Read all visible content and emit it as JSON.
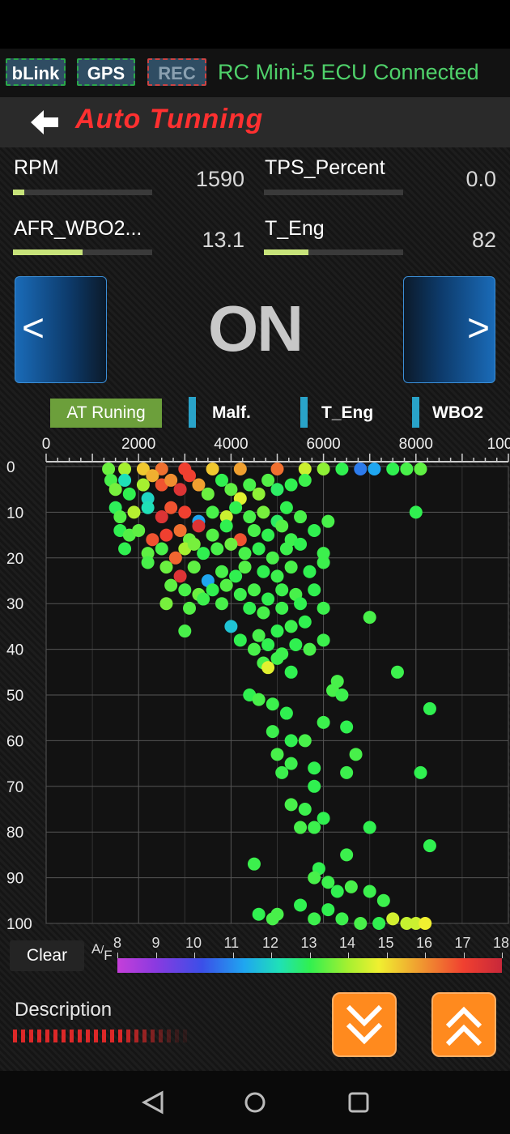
{
  "top": {
    "tags": [
      "bLink",
      "GPS",
      "REC"
    ],
    "connection": "RC Mini-5 ECU Connected"
  },
  "header": {
    "title": "Auto Tunning"
  },
  "gauges": [
    {
      "label": "RPM",
      "value": "1590",
      "fill": 0.08
    },
    {
      "label": "TPS_Percent",
      "value": "0.0",
      "fill": 0.0
    },
    {
      "label": "AFR_WBO2...",
      "value": "13.1",
      "fill": 0.5
    },
    {
      "label": "T_Eng",
      "value": "82",
      "fill": 0.32
    }
  ],
  "mode": {
    "state": "ON",
    "prev": "<",
    "next": ">"
  },
  "legend": {
    "at": "AT Runing",
    "items": [
      "Malf.",
      "T_Eng",
      "WBO2"
    ],
    "marker_color": "#29a3c9"
  },
  "chart_data": {
    "type": "scatter",
    "xlabel": "",
    "ylabel": "",
    "xticks": [
      "0",
      "2000",
      "4000",
      "6000",
      "8000",
      "10000"
    ],
    "yticks": [
      "0",
      "10",
      "20",
      "30",
      "40",
      "50",
      "60",
      "70",
      "80",
      "90",
      "100"
    ],
    "xlim": [
      0,
      10000
    ],
    "ylim": [
      0,
      100
    ],
    "color_scale": {
      "label": "A/F",
      "ticks": [
        "8",
        "9",
        "10",
        "11",
        "12",
        "13",
        "14",
        "15",
        "16",
        "17",
        "18"
      ],
      "min": 8,
      "max": 18
    },
    "points": [
      [
        1350,
        0,
        13.5
      ],
      [
        1700,
        0,
        14.0
      ],
      [
        2100,
        0,
        15.5
      ],
      [
        2500,
        0,
        16.5
      ],
      [
        3000,
        0,
        17.0
      ],
      [
        3600,
        0,
        15.5
      ],
      [
        4200,
        0,
        16.0
      ],
      [
        5000,
        0,
        16.5
      ],
      [
        5600,
        0,
        14.5
      ],
      [
        6000,
        0,
        13.8
      ],
      [
        6400,
        0,
        13.0
      ],
      [
        6800,
        0,
        10.5
      ],
      [
        7100,
        0,
        11.0
      ],
      [
        7500,
        0,
        13.0
      ],
      [
        7800,
        0,
        13.2
      ],
      [
        8100,
        0,
        13.4
      ],
      [
        1400,
        3,
        13.2
      ],
      [
        1500,
        5,
        13.6
      ],
      [
        1700,
        3,
        12.0
      ],
      [
        1800,
        6,
        13.0
      ],
      [
        2100,
        4,
        14.0
      ],
      [
        2200,
        7,
        11.8
      ],
      [
        2300,
        2,
        15.8
      ],
      [
        2500,
        4,
        16.8
      ],
      [
        2700,
        3,
        16.2
      ],
      [
        2900,
        5,
        17.5
      ],
      [
        3100,
        2,
        17.0
      ],
      [
        3300,
        4,
        16.0
      ],
      [
        3500,
        6,
        13.5
      ],
      [
        3800,
        3,
        13.0
      ],
      [
        4000,
        5,
        13.4
      ],
      [
        4200,
        7,
        14.8
      ],
      [
        4400,
        4,
        13.2
      ],
      [
        4600,
        6,
        13.8
      ],
      [
        4800,
        3,
        13.3
      ],
      [
        5000,
        5,
        12.8
      ],
      [
        5300,
        4,
        13.0
      ],
      [
        5600,
        3,
        13.1
      ],
      [
        1500,
        9,
        12.9
      ],
      [
        1600,
        11,
        13.3
      ],
      [
        1900,
        10,
        14.2
      ],
      [
        2200,
        9,
        12.0
      ],
      [
        2500,
        11,
        17.5
      ],
      [
        2700,
        9,
        16.8
      ],
      [
        3000,
        10,
        17.0
      ],
      [
        3300,
        12,
        11.0
      ],
      [
        3600,
        10,
        13.2
      ],
      [
        3900,
        11,
        14.5
      ],
      [
        4100,
        9,
        13.0
      ],
      [
        4400,
        11,
        13.2
      ],
      [
        4700,
        10,
        13.6
      ],
      [
        5000,
        12,
        12.8
      ],
      [
        5200,
        9,
        13.0
      ],
      [
        5500,
        11,
        13.2
      ],
      [
        8000,
        10,
        13.0
      ],
      [
        1600,
        14,
        13.0
      ],
      [
        1800,
        15,
        13.3
      ],
      [
        2000,
        14,
        13.4
      ],
      [
        2300,
        16,
        16.8
      ],
      [
        2600,
        15,
        17.0
      ],
      [
        2900,
        14,
        16.5
      ],
      [
        3100,
        16,
        13.5
      ],
      [
        3300,
        13,
        17.5
      ],
      [
        3600,
        15,
        13.3
      ],
      [
        3900,
        13,
        13.0
      ],
      [
        4200,
        16,
        16.8
      ],
      [
        4500,
        14,
        13.2
      ],
      [
        4800,
        15,
        13.0
      ],
      [
        5100,
        13,
        13.3
      ],
      [
        5300,
        16,
        13.1
      ],
      [
        5800,
        14,
        13.0
      ],
      [
        6100,
        12,
        13.2
      ],
      [
        1700,
        18,
        13.0
      ],
      [
        2200,
        19,
        13.4
      ],
      [
        2500,
        18,
        13.2
      ],
      [
        2800,
        20,
        16.6
      ],
      [
        3000,
        18,
        14.0
      ],
      [
        3200,
        17,
        13.6
      ],
      [
        3400,
        19,
        13.0
      ],
      [
        3700,
        18,
        13.2
      ],
      [
        4000,
        17,
        13.5
      ],
      [
        4300,
        19,
        13.2
      ],
      [
        4600,
        18,
        13.0
      ],
      [
        4900,
        20,
        13.2
      ],
      [
        5200,
        18,
        13.1
      ],
      [
        5500,
        17,
        13.0
      ],
      [
        6000,
        19,
        13.1
      ],
      [
        2200,
        21,
        13.2
      ],
      [
        2600,
        22,
        13.5
      ],
      [
        2900,
        24,
        17.5
      ],
      [
        3200,
        22,
        13.4
      ],
      [
        3500,
        25,
        11.0
      ],
      [
        3800,
        23,
        13.2
      ],
      [
        4100,
        24,
        13.0
      ],
      [
        4300,
        22,
        13.3
      ],
      [
        4700,
        23,
        13.0
      ],
      [
        5000,
        24,
        13.1
      ],
      [
        5300,
        22,
        13.2
      ],
      [
        5700,
        23,
        13.0
      ],
      [
        6000,
        21,
        13.1
      ],
      [
        2700,
        26,
        13.4
      ],
      [
        3000,
        27,
        13.2
      ],
      [
        3300,
        28,
        13.5
      ],
      [
        3600,
        27,
        13.0
      ],
      [
        3900,
        26,
        13.3
      ],
      [
        4200,
        28,
        13.1
      ],
      [
        4500,
        27,
        13.2
      ],
      [
        4800,
        29,
        13.0
      ],
      [
        5100,
        27,
        13.1
      ],
      [
        5400,
        28,
        13.2
      ],
      [
        5800,
        27,
        13.0
      ],
      [
        2600,
        30,
        13.6
      ],
      [
        3100,
        31,
        13.3
      ],
      [
        3400,
        29,
        13.1
      ],
      [
        3800,
        30,
        13.2
      ],
      [
        4400,
        31,
        13.0
      ],
      [
        4700,
        32,
        13.2
      ],
      [
        5100,
        31,
        13.1
      ],
      [
        5500,
        30,
        13.0
      ],
      [
        6000,
        31,
        13.1
      ],
      [
        3000,
        36,
        13.2
      ],
      [
        4000,
        35,
        11.5
      ],
      [
        4600,
        37,
        13.2
      ],
      [
        5000,
        36,
        13.0
      ],
      [
        5300,
        35,
        13.1
      ],
      [
        5600,
        34,
        13.0
      ],
      [
        7000,
        33,
        13.2
      ],
      [
        4200,
        38,
        13.0
      ],
      [
        4500,
        40,
        13.2
      ],
      [
        4800,
        39,
        13.0
      ],
      [
        5100,
        41,
        13.1
      ],
      [
        5400,
        39,
        13.0
      ],
      [
        5700,
        40,
        13.2
      ],
      [
        6000,
        38,
        13.1
      ],
      [
        4700,
        43,
        13.2
      ],
      [
        4800,
        44,
        14.8
      ],
      [
        5000,
        42,
        13.1
      ],
      [
        5300,
        45,
        13.0
      ],
      [
        6300,
        47,
        13.2
      ],
      [
        7600,
        45,
        13.1
      ],
      [
        4400,
        50,
        13.0
      ],
      [
        4600,
        51,
        13.2
      ],
      [
        4900,
        52,
        13.1
      ],
      [
        5200,
        54,
        13.0
      ],
      [
        6200,
        49,
        13.2
      ],
      [
        6400,
        50,
        13.1
      ],
      [
        8300,
        53,
        13.0
      ],
      [
        4900,
        58,
        13.1
      ],
      [
        5300,
        60,
        13.0
      ],
      [
        5600,
        60,
        13.2
      ],
      [
        6000,
        56,
        13.1
      ],
      [
        6500,
        57,
        13.0
      ],
      [
        5000,
        63,
        13.2
      ],
      [
        5300,
        65,
        13.1
      ],
      [
        5800,
        66,
        13.0
      ],
      [
        6700,
        63,
        13.2
      ],
      [
        6500,
        67,
        13.1
      ],
      [
        8100,
        67,
        13.0
      ],
      [
        5100,
        67,
        13.1
      ],
      [
        5800,
        70,
        13.0
      ],
      [
        5300,
        74,
        13.2
      ],
      [
        5600,
        75,
        13.1
      ],
      [
        6000,
        77,
        13.0
      ],
      [
        5500,
        79,
        13.2
      ],
      [
        5800,
        79,
        13.1
      ],
      [
        7000,
        79,
        13.0
      ],
      [
        4500,
        87,
        13.1
      ],
      [
        5900,
        88,
        13.0
      ],
      [
        5800,
        90,
        13.2
      ],
      [
        6100,
        91,
        13.1
      ],
      [
        6300,
        93,
        13.0
      ],
      [
        6600,
        92,
        13.2
      ],
      [
        7000,
        93,
        13.1
      ],
      [
        8300,
        83,
        13.0
      ],
      [
        6500,
        85,
        13.1
      ],
      [
        5000,
        98,
        13.2
      ],
      [
        5500,
        96,
        13.0
      ],
      [
        5800,
        99,
        13.1
      ],
      [
        6100,
        97,
        13.0
      ],
      [
        6400,
        99,
        13.1
      ],
      [
        6800,
        100,
        13.2
      ],
      [
        7200,
        100,
        13.0
      ],
      [
        7500,
        99,
        14.6
      ],
      [
        7800,
        100,
        14.4
      ],
      [
        8000,
        100,
        14.5
      ],
      [
        8200,
        100,
        15.0
      ],
      [
        7300,
        95,
        13.1
      ],
      [
        4600,
        98,
        13.0
      ],
      [
        4900,
        99,
        13.2
      ]
    ]
  },
  "controls": {
    "clear": "Clear",
    "af_label_a": "A",
    "af_label_f": "F"
  },
  "footer": {
    "description": "Description"
  }
}
